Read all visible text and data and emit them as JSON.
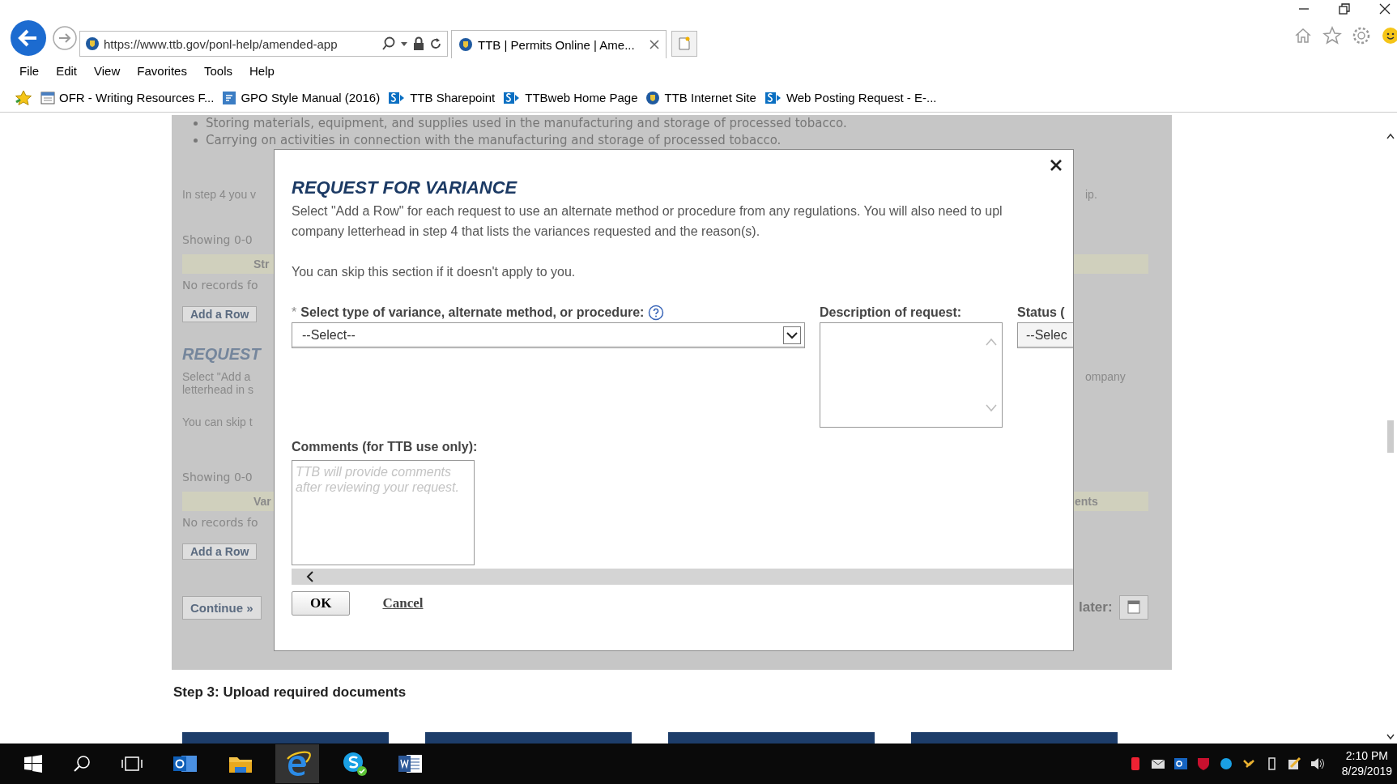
{
  "browser": {
    "address": "https://www.ttb.gov/ponl-help/amended-app",
    "tab_title": "TTB | Permits Online | Ame...",
    "menu": [
      "File",
      "Edit",
      "View",
      "Favorites",
      "Tools",
      "Help"
    ],
    "favorites": [
      {
        "label": "OFR - Writing Resources F...",
        "kind": "page"
      },
      {
        "label": "GPO Style Manual (2016)",
        "kind": "doc"
      },
      {
        "label": "TTB Sharepoint",
        "kind": "sharepoint"
      },
      {
        "label": "TTBweb Home Page",
        "kind": "sharepoint"
      },
      {
        "label": "TTB Internet Site",
        "kind": "shield"
      },
      {
        "label": "Web Posting Request - E-...",
        "kind": "sharepoint"
      }
    ]
  },
  "background_page": {
    "bullets": [
      "Storing materials, equipment, and supplies used in the manufacturing and storage of processed tobacco.",
      "Carrying on activities in connection with the manufacturing and storage of processed tobacco."
    ],
    "intro": {
      "left": "In step 4 you v",
      "right": "ip."
    },
    "table_1": {
      "showing": "Showing 0-0",
      "header_left": "Str",
      "no_records": "No records fo",
      "add_button": "Add a Row"
    },
    "heading": "REQUEST",
    "paragraph": {
      "line_1_left": "Select \"Add a",
      "line_1_right": "ompany",
      "line_2": "letterhead in s"
    },
    "skip_text": "You can skip t",
    "table_2": {
      "showing": "Showing 0-0",
      "header_left": "Var",
      "header_right": "ents",
      "no_records": "No records fo",
      "add_button": "Add a Row"
    },
    "continue_button": "Continue »",
    "save_label": "later:"
  },
  "step_3_heading": "Step 3: Upload required documents",
  "dialog": {
    "title": "REQUEST FOR VARIANCE",
    "paragraph_lines": [
      "Select \"Add a Row\" for each request to use an alternate method or procedure from any regulations. You will also need to upl",
      "company letterhead in step 4 that lists the variances requested and the reason(s)."
    ],
    "skip_note": "You can skip this section if it doesn't apply to you.",
    "type_field": {
      "required_mark": "*",
      "label": "Select type of variance, alternate method, or procedure:",
      "value": "--Select--"
    },
    "description_label": "Description of request:",
    "status_field": {
      "label": "Status (",
      "value": "--Selec"
    },
    "comments_field": {
      "label": "Comments (for TTB use only):",
      "placeholder": "TTB will provide comments after reviewing your request."
    },
    "ok_button": "OK",
    "cancel_link": "Cancel"
  },
  "taskbar": {
    "time": "2:10 PM",
    "date": "8/29/2019"
  }
}
